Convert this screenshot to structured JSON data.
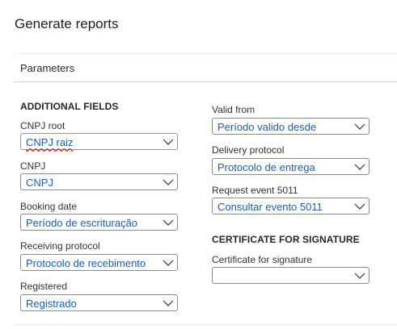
{
  "page": {
    "title": "Generate reports"
  },
  "section": {
    "title": "Parameters"
  },
  "left": {
    "group_title": "ADDITIONAL FIELDS",
    "fields": [
      {
        "label": "CNPJ root",
        "value": "CNPJ raiz"
      },
      {
        "label": "CNPJ",
        "value": "CNPJ"
      },
      {
        "label": "Booking date",
        "value": "Período de escrituração"
      },
      {
        "label": "Receiving protocol",
        "value": "Protocolo de recebimento"
      },
      {
        "label": "Registered",
        "value": "Registrado"
      }
    ]
  },
  "right": {
    "fields": [
      {
        "label": "Valid from",
        "value": "Período valido desde"
      },
      {
        "label": "Delivery protocol",
        "value": "Protocolo de entrega"
      },
      {
        "label": "Request event 5011",
        "value": "Consultar evento 5011"
      }
    ],
    "cert_group_title": "CERTIFICATE FOR SIGNATURE",
    "cert_field": {
      "label": "Certificate for signature",
      "value": ""
    }
  },
  "icons": {
    "dropdown": "chevron-down-icon"
  },
  "colors": {
    "value_text": "#1a5fb4",
    "focus_border": "#9aa33a",
    "spell_underline": "#c42b1c"
  }
}
